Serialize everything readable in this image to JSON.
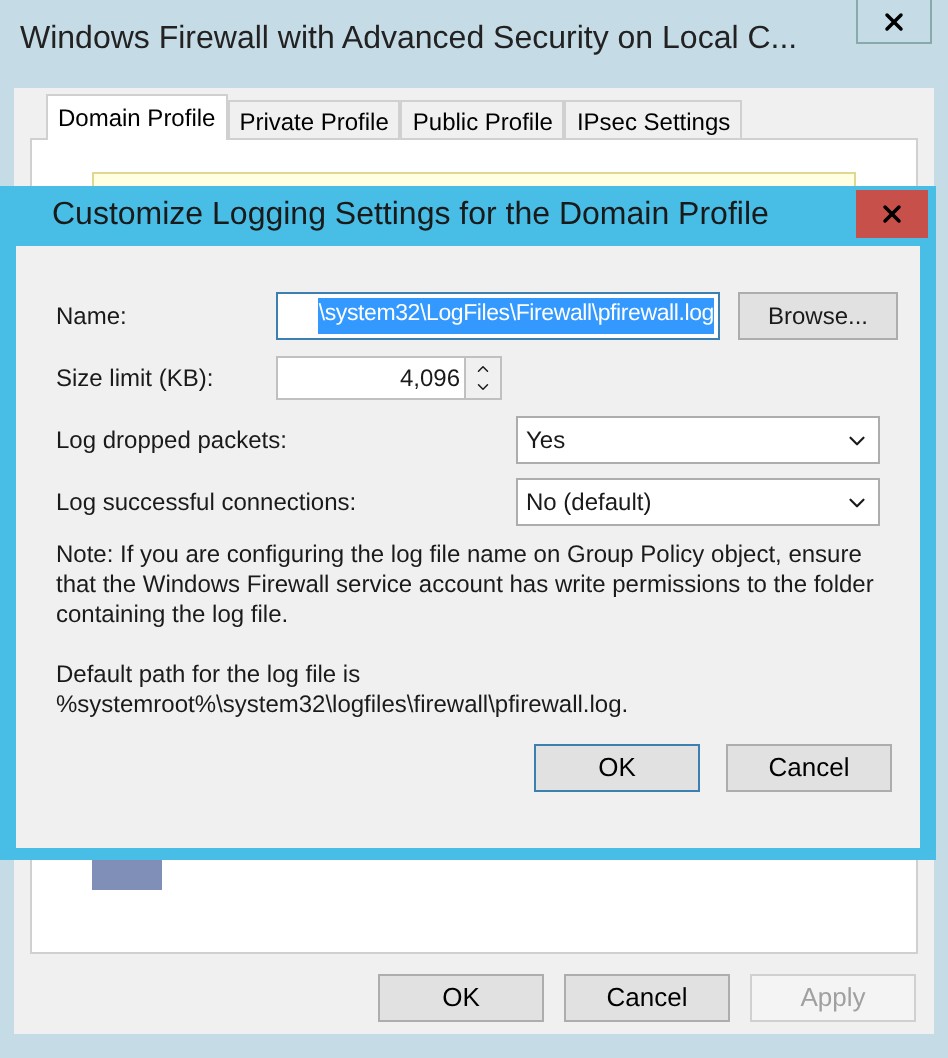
{
  "window": {
    "title": "Windows Firewall with Advanced Security on Local C..."
  },
  "tabs": [
    {
      "label": "Domain Profile",
      "selected": true
    },
    {
      "label": "Private Profile",
      "selected": false
    },
    {
      "label": "Public Profile",
      "selected": false
    },
    {
      "label": "IPsec Settings",
      "selected": false
    }
  ],
  "buttons": [
    {
      "label": "OK",
      "disabled": false
    },
    {
      "label": "Cancel",
      "disabled": false
    },
    {
      "label": "Apply",
      "disabled": true
    }
  ],
  "dialog": {
    "title": "Customize Logging Settings for the Domain Profile",
    "fields": [
      {
        "kind": "text",
        "label": "Name:",
        "value": "\\system32\\LogFiles\\Firewall\\pfirewall.log",
        "highlighted": true,
        "button": "Browse..."
      },
      {
        "kind": "spinner",
        "label": "Size limit (KB):",
        "value": "4,096"
      },
      {
        "kind": "dropdown",
        "label": "Log dropped packets:",
        "value": "Yes"
      },
      {
        "kind": "dropdown",
        "label": "Log successful connections:",
        "value": "No (default)"
      }
    ],
    "note": "Note: If you are configuring the log file name on Group Policy object, ensure that the Windows Firewall service account has write permissions to the folder containing the log file.",
    "default_path": "Default path for the log file is %systemroot%\\system32\\logfiles\\firewall\\pfirewall.log.",
    "buttons": [
      {
        "label": "OK",
        "disabled": false
      },
      {
        "label": "Cancel",
        "disabled": false
      }
    ]
  }
}
